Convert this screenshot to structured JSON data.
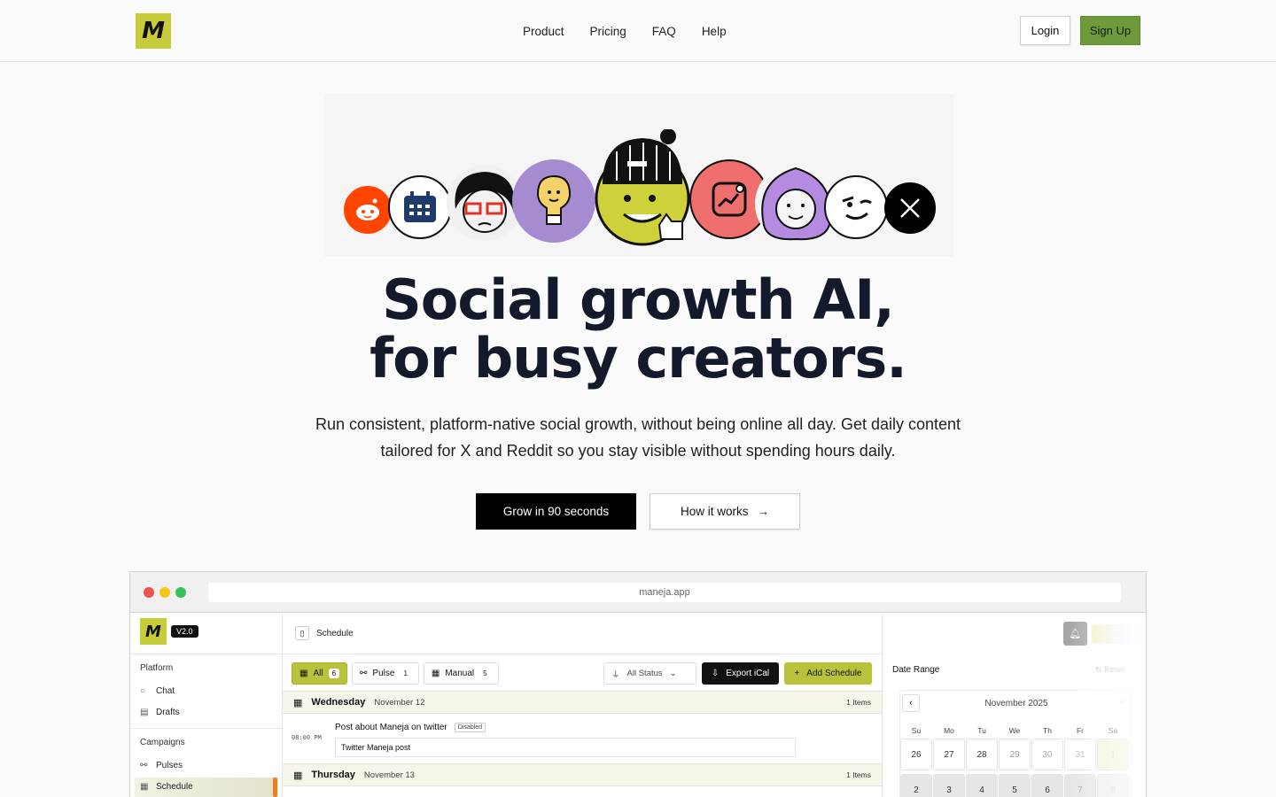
{
  "header": {
    "logo_letter": "M",
    "nav": [
      "Product",
      "Pricing",
      "FAQ",
      "Help"
    ],
    "login": "Login",
    "signup": "Sign Up"
  },
  "hero": {
    "title_line1": "Social growth AI,",
    "title_line2": "for busy creators.",
    "subtitle_line1": "Run consistent, platform-native social growth, without being online all day. Get daily content",
    "subtitle_line2": "tailored for X and Reddit so you stay visible without spending hours daily.",
    "cta_primary": "Grow in 90 seconds",
    "cta_secondary": "How it works",
    "illustration_icons": [
      "reddit-icon",
      "calendar-icon",
      "glasses-person-icon",
      "lightbulb-icon",
      "mascot-icon",
      "growth-chart-icon",
      "curly-hair-person-icon",
      "winking-face-icon",
      "x-logo-icon"
    ],
    "colors": {
      "accent": "#c6cc3a",
      "signup": "#6f9a3c",
      "reddit": "#ff4500",
      "bulb": "#a58bd0",
      "growth": "#ef6f6f",
      "hair": "#b48be0"
    }
  },
  "browser": {
    "url": "maneja.app",
    "app": {
      "logo_letter": "M",
      "version": "V2.0",
      "sidebar": {
        "platform_label": "Platform",
        "platform_items": [
          "Chat",
          "Drafts"
        ],
        "campaigns_label": "Campaigns",
        "campaign_items": [
          "Pulses",
          "Schedule"
        ]
      },
      "breadcrumb": "Schedule",
      "tabs": [
        {
          "label": "All",
          "count": "6"
        },
        {
          "label": "Pulse",
          "count": "1"
        },
        {
          "label": "Manual",
          "count": "5"
        }
      ],
      "status_filter": "All Status",
      "export_label": "Export iCal",
      "add_label": "Add Schedule",
      "days": [
        {
          "day": "Wednesday",
          "date": "November 12",
          "count": "1 Items"
        },
        {
          "day": "Thursday",
          "date": "November 13",
          "count": "1 Items"
        }
      ],
      "post": {
        "time": "08:00 PM",
        "title": "Post about Maneja on twitter",
        "status": "Disabled",
        "content": "Twitter Maneja post"
      },
      "calendar": {
        "label": "Date Range",
        "reset": "Reset",
        "month": "November 2025",
        "weekdays": [
          "Su",
          "Mo",
          "Tu",
          "We",
          "Th",
          "Fr",
          "Sa"
        ],
        "week1": [
          "26",
          "27",
          "28",
          "29",
          "30",
          "31",
          "1"
        ],
        "week2": [
          "2",
          "3",
          "4",
          "5",
          "6",
          "7",
          "8"
        ]
      }
    }
  }
}
